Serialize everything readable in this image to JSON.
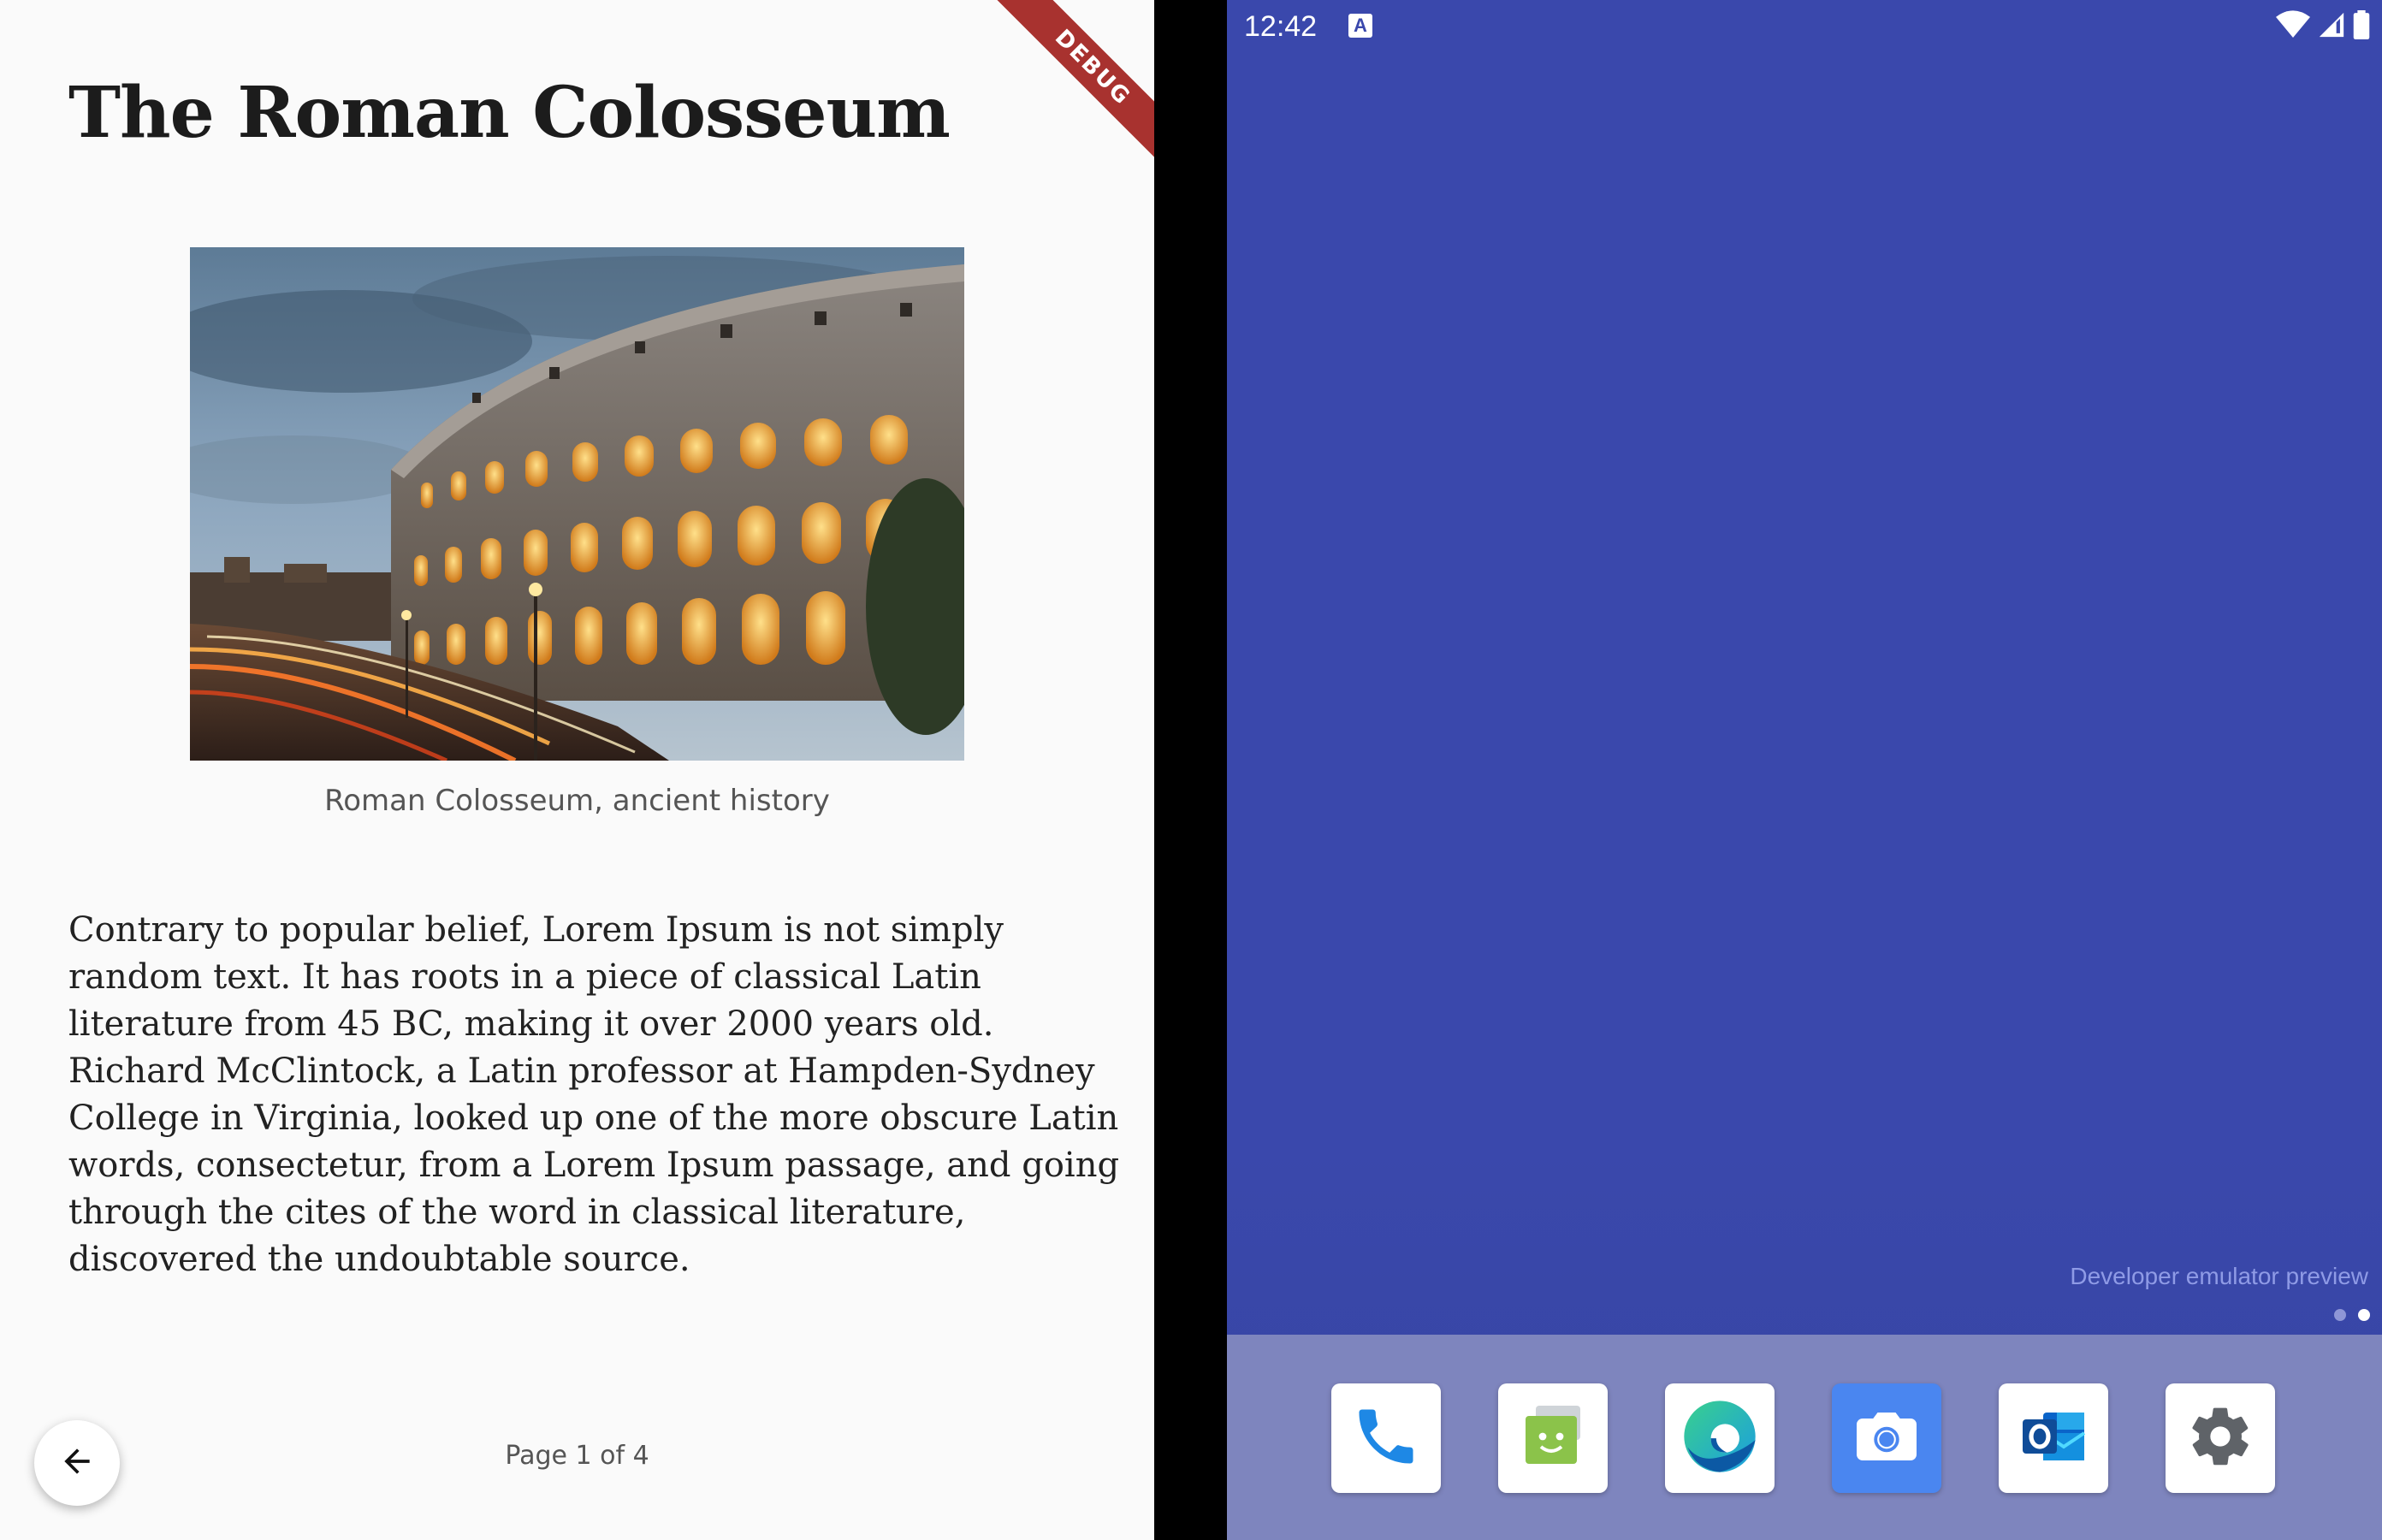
{
  "left_app": {
    "title": "The Roman Colosseum",
    "debug_banner": "DEBUG",
    "figure_caption": "Roman Colosseum, ancient history",
    "body_text": "Contrary to popular belief, Lorem Ipsum is not simply random text. It has roots in a piece of classical Latin literature from 45 BC, making it over 2000 years old. Richard McClintock, a Latin professor at Hampden-Sydney College in Virginia, looked up one of the more obscure Latin words, consectetur, from a Lorem Ipsum passage, and going through the cites of the word in classical literature, discovered the undoubtable source.",
    "page_indicator": "Page 1 of 4",
    "back_icon": "arrow-left-icon"
  },
  "right_launcher": {
    "status_bar": {
      "time": "12:42",
      "notification_icon": "A",
      "icons": [
        "wifi-icon",
        "cell-signal-icon",
        "battery-icon"
      ]
    },
    "watermark": "Developer emulator preview",
    "page_dots": {
      "count": 2,
      "active_index": 1
    },
    "dock_apps": [
      "phone-icon",
      "messages-icon",
      "edge-browser-icon",
      "camera-icon",
      "outlook-icon",
      "settings-icon"
    ],
    "wallpaper_color": "#3A48AC",
    "dock_color": "#7E85BE"
  }
}
